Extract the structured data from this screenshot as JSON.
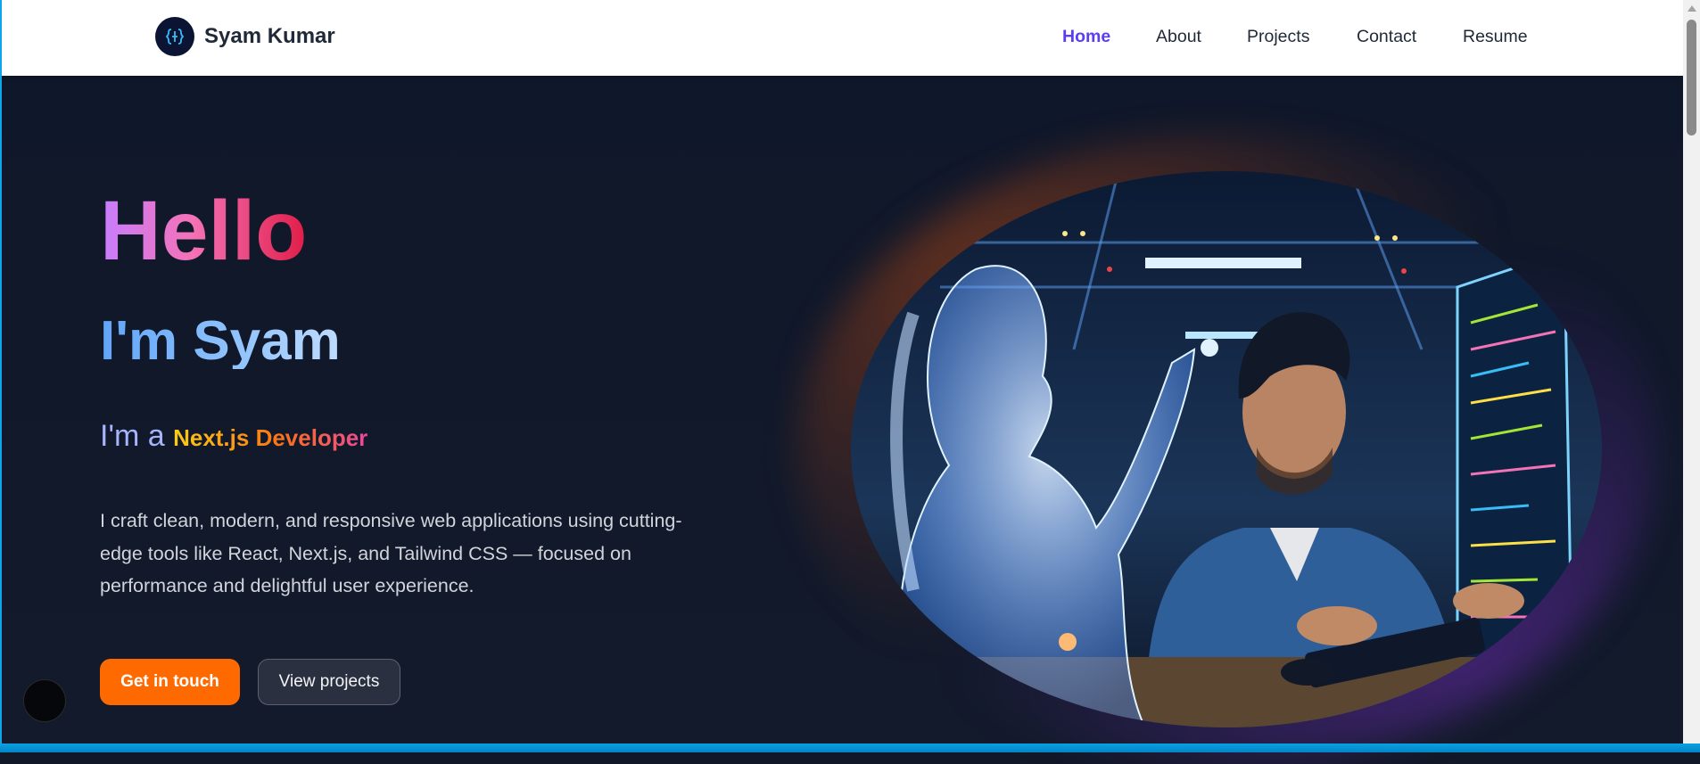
{
  "nav": {
    "brand": "Syam Kumar",
    "links": [
      {
        "label": "Home",
        "active": true
      },
      {
        "label": "About",
        "active": false
      },
      {
        "label": "Projects",
        "active": false
      },
      {
        "label": "Contact",
        "active": false
      },
      {
        "label": "Resume",
        "active": false
      }
    ]
  },
  "hero": {
    "greeting": "Hello",
    "name": "I'm Syam",
    "role_prefix": "I'm a",
    "role_highlight": "Next.js Developer",
    "description": "I craft clean, modern, and responsive web applications using cutting-edge tools like React, Next.js, and Tailwind CSS — focused on performance and delightful user experience.",
    "primary_button": "Get in touch",
    "secondary_button": "View projects"
  },
  "colors": {
    "accent": "#5b3df5",
    "primary_button": "#ff6a00",
    "background": "#111827"
  }
}
